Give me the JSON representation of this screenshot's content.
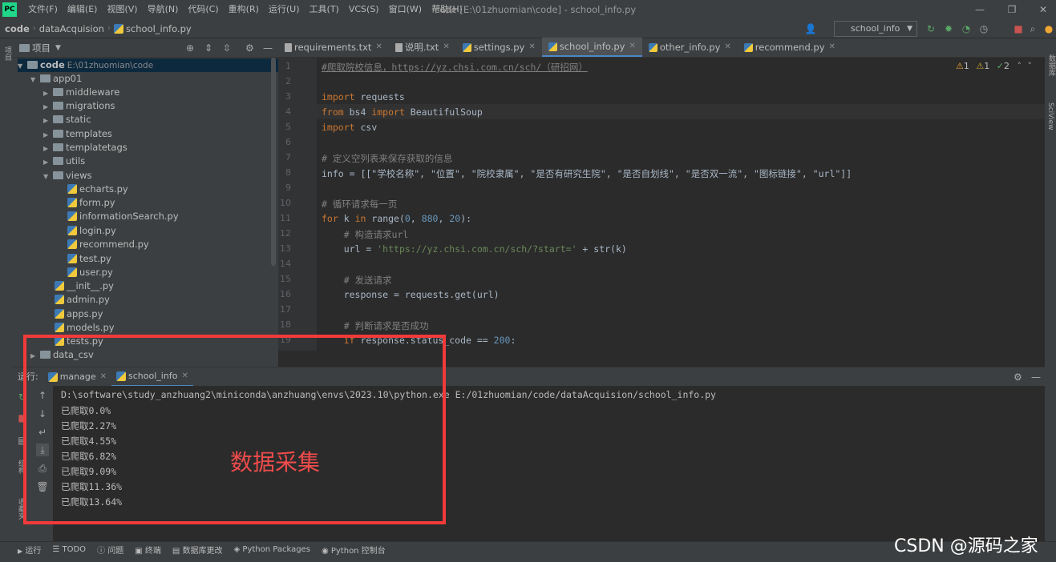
{
  "menus": [
    "文件(F)",
    "编辑(E)",
    "视图(V)",
    "导航(N)",
    "代码(C)",
    "重构(R)",
    "运行(U)",
    "工具(T)",
    "VCS(S)",
    "窗口(W)",
    "帮助(H)"
  ],
  "window_title": "code [E:\\01zhuomian\\code] - school_info.py",
  "breadcrumbs": [
    "code",
    "dataAcquision",
    "school_info.py"
  ],
  "run_config": "school_info",
  "left_stripe_label": "项目",
  "right_stripe_labels": [
    "数据库",
    "SciView"
  ],
  "project": {
    "title": "项目",
    "tree": [
      {
        "label": "code",
        "hint": "E:\\01zhuomian\\code",
        "type": "folder",
        "expanded": true
      },
      {
        "label": "app01",
        "type": "folder",
        "expanded": true
      },
      {
        "label": "middleware",
        "type": "folder"
      },
      {
        "label": "migrations",
        "type": "folder"
      },
      {
        "label": "static",
        "type": "folder"
      },
      {
        "label": "templates",
        "type": "folder"
      },
      {
        "label": "templatetags",
        "type": "folder"
      },
      {
        "label": "utils",
        "type": "folder"
      },
      {
        "label": "views",
        "type": "folder",
        "expanded": true
      },
      {
        "label": "echarts.py",
        "type": "py"
      },
      {
        "label": "form.py",
        "type": "py"
      },
      {
        "label": "informationSearch.py",
        "type": "py"
      },
      {
        "label": "login.py",
        "type": "py"
      },
      {
        "label": "recommend.py",
        "type": "py"
      },
      {
        "label": "test.py",
        "type": "py"
      },
      {
        "label": "user.py",
        "type": "py"
      },
      {
        "label": "__init__.py",
        "type": "py"
      },
      {
        "label": "admin.py",
        "type": "py"
      },
      {
        "label": "apps.py",
        "type": "py"
      },
      {
        "label": "models.py",
        "type": "py"
      },
      {
        "label": "tests.py",
        "type": "py"
      },
      {
        "label": "data_csv",
        "type": "folder"
      }
    ]
  },
  "editor_tabs": [
    {
      "label": "requirements.txt",
      "active": false
    },
    {
      "label": "说明.txt",
      "active": false
    },
    {
      "label": "settings.py",
      "active": false
    },
    {
      "label": "school_info.py",
      "active": true
    },
    {
      "label": "other_info.py",
      "active": false
    },
    {
      "label": "recommend.py",
      "active": false
    }
  ],
  "inspections": {
    "warnings": "1",
    "weak": "1",
    "ok": "2"
  },
  "code_lines": [
    "#爬取院校信息，https://yz.chsi.com.cn/sch/（研招网）",
    "",
    "import requests",
    "from bs4 import BeautifulSoup",
    "import csv",
    "",
    "# 定义空列表来保存获取的信息",
    "info = [[\"学校名称\", \"位置\", \"院校隶属\", \"是否有研究生院\", \"是否自划线\", \"是否双一流\", \"图标链接\", \"url\"]]",
    "",
    "# 循环请求每一页",
    "for k in range(0, 880, 20):",
    "    # 构造请求url",
    "    url = 'https://yz.chsi.com.cn/sch/?start=' + str(k)",
    "",
    "    # 发送请求",
    "    response = requests.get(url)",
    "",
    "    # 判断请求是否成功",
    "    if response.status_code == 200:"
  ],
  "run_panel": {
    "label": "运行:",
    "tabs": [
      {
        "label": "manage",
        "active": false
      },
      {
        "label": "school_info",
        "active": true
      }
    ],
    "console": [
      "D:\\software\\study_anzhuang2\\miniconda\\anzhuang\\envs\\2023.10\\python.exe E:/01zhuomian/code/dataAcquision/school_info.py",
      "已爬取0.0%",
      "已爬取2.27%",
      "已爬取4.55%",
      "已爬取6.82%",
      "已爬取9.09%",
      "已爬取11.36%",
      "已爬取13.64%"
    ]
  },
  "annotation": {
    "text": "数据采集",
    "color": "#f23a3a"
  },
  "bottom_tabs": [
    "运行",
    "TODO",
    "问题",
    "终端",
    "数据库更改",
    "Python Packages",
    "Python 控制台"
  ],
  "watermark": "CSDN @源码之家",
  "colors": {
    "accent": "#4a88c7",
    "keyword": "#cc7832",
    "comment": "#808080",
    "string": "#6a8759",
    "number": "#6897bb"
  }
}
